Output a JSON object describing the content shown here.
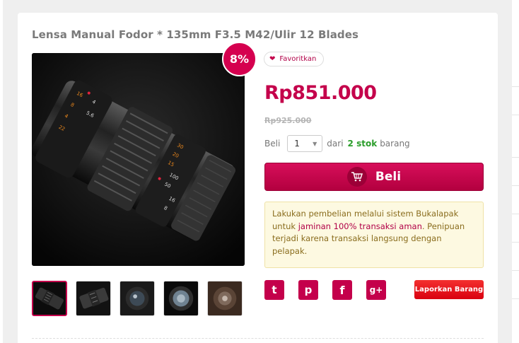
{
  "product": {
    "title": "Lensa Manual Fodor * 135mm F3.5 M42/Ulir 12 Blades",
    "discount": "8%",
    "favorite_label": "Favoritkan",
    "price": "Rp851.000",
    "old_price": "Rp925.000"
  },
  "purchase": {
    "buy_label": "Beli",
    "quantity": "1",
    "from_label": "dari",
    "stock": "2 stok",
    "unit_label": "barang",
    "button_label": "Beli"
  },
  "notice": {
    "part1": "Lakukan pembelian melalui sistem Bukalapak untuk ",
    "highlight": "jaminan 100% transaksi aman",
    "part2": ". Penipuan terjadi karena transaksi langsung dengan pelapak."
  },
  "thumbnails": [
    {
      "name": "thumb-1",
      "active": true
    },
    {
      "name": "thumb-2",
      "active": false
    },
    {
      "name": "thumb-3",
      "active": false
    },
    {
      "name": "thumb-4",
      "active": false
    },
    {
      "name": "thumb-5",
      "active": false
    }
  ],
  "share": {
    "icons": [
      "twitter-icon",
      "pinterest-icon",
      "facebook-icon",
      "google-plus-icon"
    ],
    "twitter": "t",
    "pinterest": "p",
    "facebook": "f",
    "google_plus": "g+"
  },
  "report_label": "Laporkan Barang",
  "colors": {
    "brand": "#c4004b",
    "stock": "#2a9d2a",
    "report": "#e8161b",
    "notice_bg": "#fdf9e1"
  }
}
